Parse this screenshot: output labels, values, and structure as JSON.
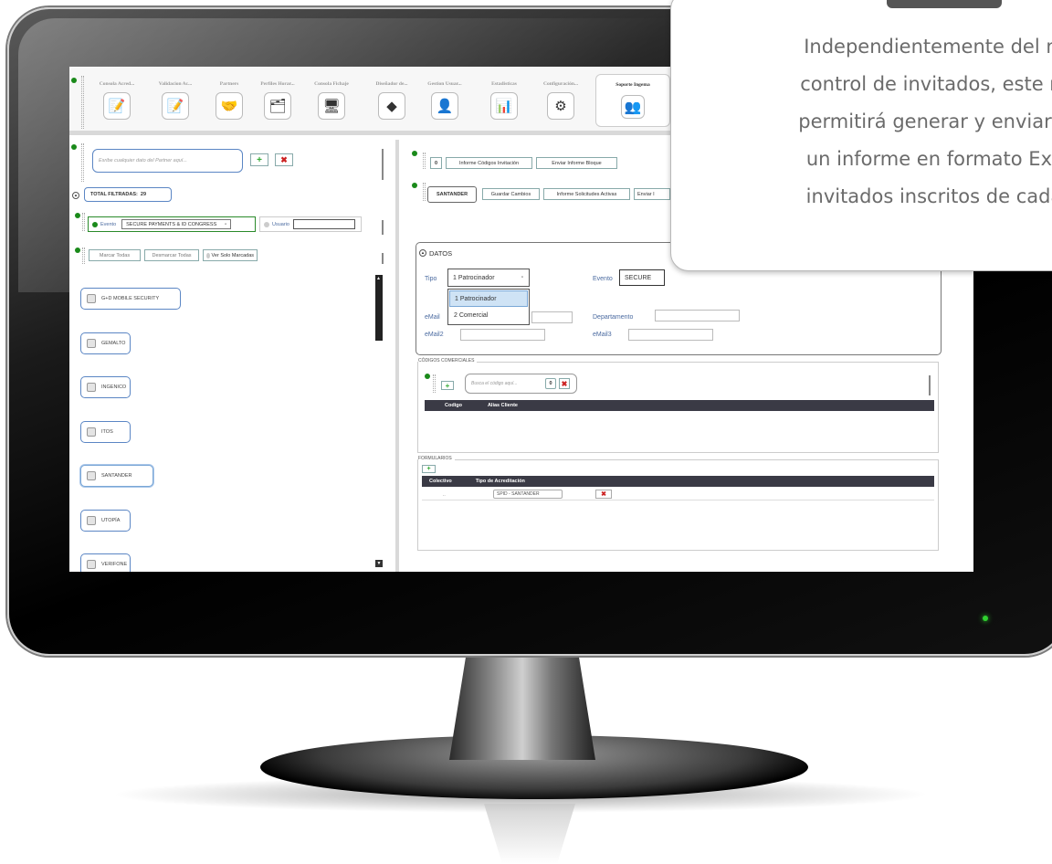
{
  "toolbar": {
    "items": [
      {
        "label": "Consola Acred...",
        "icon": "edit-form-icon",
        "glyph": "📝"
      },
      {
        "label": "Validacion Ac...",
        "icon": "edit-doc-icon",
        "glyph": "📝"
      },
      {
        "label": "Partners",
        "icon": "handshake-icon",
        "glyph": "🤝"
      },
      {
        "label": "Perfiles Horar...",
        "icon": "profile-schedule-icon",
        "glyph": "🗂"
      },
      {
        "label": "Consola Fichaje",
        "icon": "terminal-icon",
        "glyph": "🖥"
      },
      {
        "label": "Diseñador de...",
        "icon": "designer-icon",
        "glyph": "◆"
      },
      {
        "label": "Gestion Usuar...",
        "icon": "users-icon",
        "glyph": "👤"
      },
      {
        "label": "Estadisticas",
        "icon": "statistics-icon",
        "glyph": "📊"
      },
      {
        "label": "Configuración...",
        "icon": "settings-icon",
        "glyph": "⚙"
      }
    ],
    "active": {
      "label": "Soporte Ingema",
      "icon": "support-team-icon",
      "glyph": "👥"
    }
  },
  "left": {
    "search_placeholder": "Esribe cualquier dato del Partner aquí...",
    "total_label": "TOTAL FILTRADAS:",
    "total_value": "29",
    "evento_label": "Evento",
    "evento_value": "SECURE PAYMENTS & ID CONGRESS",
    "usuario_label": "Usuario",
    "marcar_todas": "Marcar Todas",
    "desmarcar_todas": "Desmarcar Todas",
    "ver_solo_marcadas": "Ver Solo Marcadas",
    "partners": [
      "G+D MOBILE SECURITY",
      "GEMALTO",
      "INGENICO",
      "ITOS",
      "SANTANDER",
      "UTOPÍA",
      "VERIFONE"
    ]
  },
  "right": {
    "count": "0",
    "informe_codigos": "Informe Códigos Invitación",
    "enviar_informe_bloque": "Enviar Informe Bloque",
    "partner_name": "SANTANDER",
    "guardar_cambios": "Guardar Cambios",
    "informe_solicitudes": "Informe Solicitudes Activas",
    "enviar_informe_short": "Enviar I",
    "datos_title": "DATOS",
    "tipo_label": "Tipo",
    "tipo_selected": "1 Patrocinador",
    "tipo_options": [
      "1 Patrocinador",
      "2 Comercial"
    ],
    "evento_label": "Evento",
    "evento_value": "SECURE",
    "email_label": "eMail",
    "departamento_label": "Departamento",
    "email2_label": "eMail2",
    "email3_label": "eMail3",
    "codigos_title": "CÓDIGOS COMERCIALES",
    "busca_placeholder": "Busca el código aquí...",
    "busca_count": "0",
    "col_codigo": "Codigo",
    "col_alias": "Alias Cliente",
    "formularios_title": "FORMULARIOS",
    "col_colectivo": "Colectivo",
    "col_tipo_acred": "Tipo de Acreditación",
    "row_colectivo": "..",
    "row_tipo": "SPID - SANTANDER"
  },
  "callout": {
    "lines": [
      "Independientemente del m",
      "control de invitados, este m",
      "permitirá generar y enviar p",
      "un informe en formato Exc",
      "invitados inscritos de cada"
    ]
  },
  "colors": {
    "accent_blue": "#5b86c4",
    "status_green": "#1a8a1a",
    "delete_red": "#cc2222",
    "header_dark": "#3a3a45"
  }
}
